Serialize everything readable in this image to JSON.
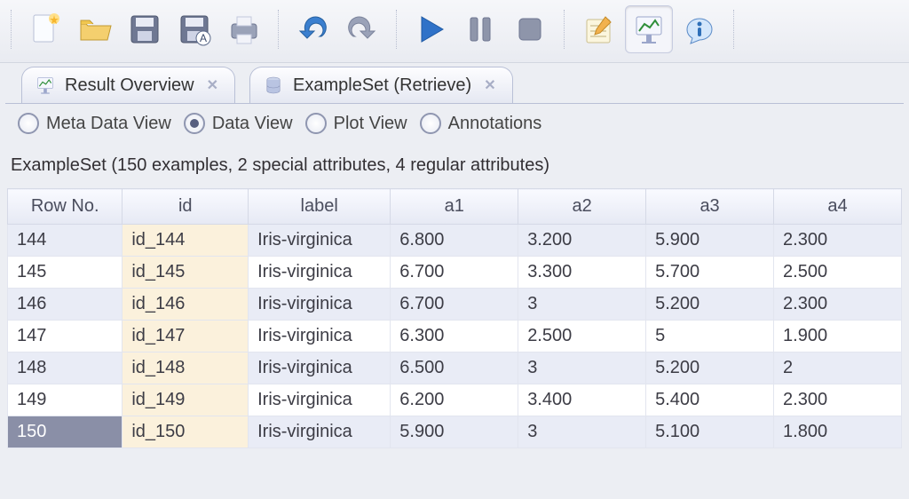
{
  "toolbar": {
    "groups": [
      [
        "new",
        "open",
        "save",
        "save-as",
        "print"
      ],
      [
        "undo",
        "redo"
      ],
      [
        "run",
        "pause",
        "stop"
      ],
      [
        "notes",
        "results",
        "info"
      ]
    ],
    "active": "results"
  },
  "tabs": [
    {
      "id": "result-overview",
      "icon": "result-overview-icon",
      "label": "Result Overview",
      "closable": true
    },
    {
      "id": "example-set",
      "icon": "database-icon",
      "label": "ExampleSet (Retrieve)",
      "closable": true
    }
  ],
  "views": {
    "meta": "Meta Data View",
    "data": "Data View",
    "plot": "Plot View",
    "annot": "Annotations",
    "selected": "data"
  },
  "summary": "ExampleSet (150 examples, 2 special attributes, 4 regular attributes)",
  "table": {
    "columns": [
      "Row No.",
      "id",
      "label",
      "a1",
      "a2",
      "a3",
      "a4"
    ],
    "rows": [
      {
        "rowno": "144",
        "id": "id_144",
        "label": "Iris-virginica",
        "a1": "6.800",
        "a2": "3.200",
        "a3": "5.900",
        "a4": "2.300"
      },
      {
        "rowno": "145",
        "id": "id_145",
        "label": "Iris-virginica",
        "a1": "6.700",
        "a2": "3.300",
        "a3": "5.700",
        "a4": "2.500"
      },
      {
        "rowno": "146",
        "id": "id_146",
        "label": "Iris-virginica",
        "a1": "6.700",
        "a2": "3",
        "a3": "5.200",
        "a4": "2.300"
      },
      {
        "rowno": "147",
        "id": "id_147",
        "label": "Iris-virginica",
        "a1": "6.300",
        "a2": "2.500",
        "a3": "5",
        "a4": "1.900"
      },
      {
        "rowno": "148",
        "id": "id_148",
        "label": "Iris-virginica",
        "a1": "6.500",
        "a2": "3",
        "a3": "5.200",
        "a4": "2"
      },
      {
        "rowno": "149",
        "id": "id_149",
        "label": "Iris-virginica",
        "a1": "6.200",
        "a2": "3.400",
        "a3": "5.400",
        "a4": "2.300"
      },
      {
        "rowno": "150",
        "id": "id_150",
        "label": "Iris-virginica",
        "a1": "5.900",
        "a2": "3",
        "a3": "5.100",
        "a4": "1.800",
        "selected": true
      }
    ]
  }
}
